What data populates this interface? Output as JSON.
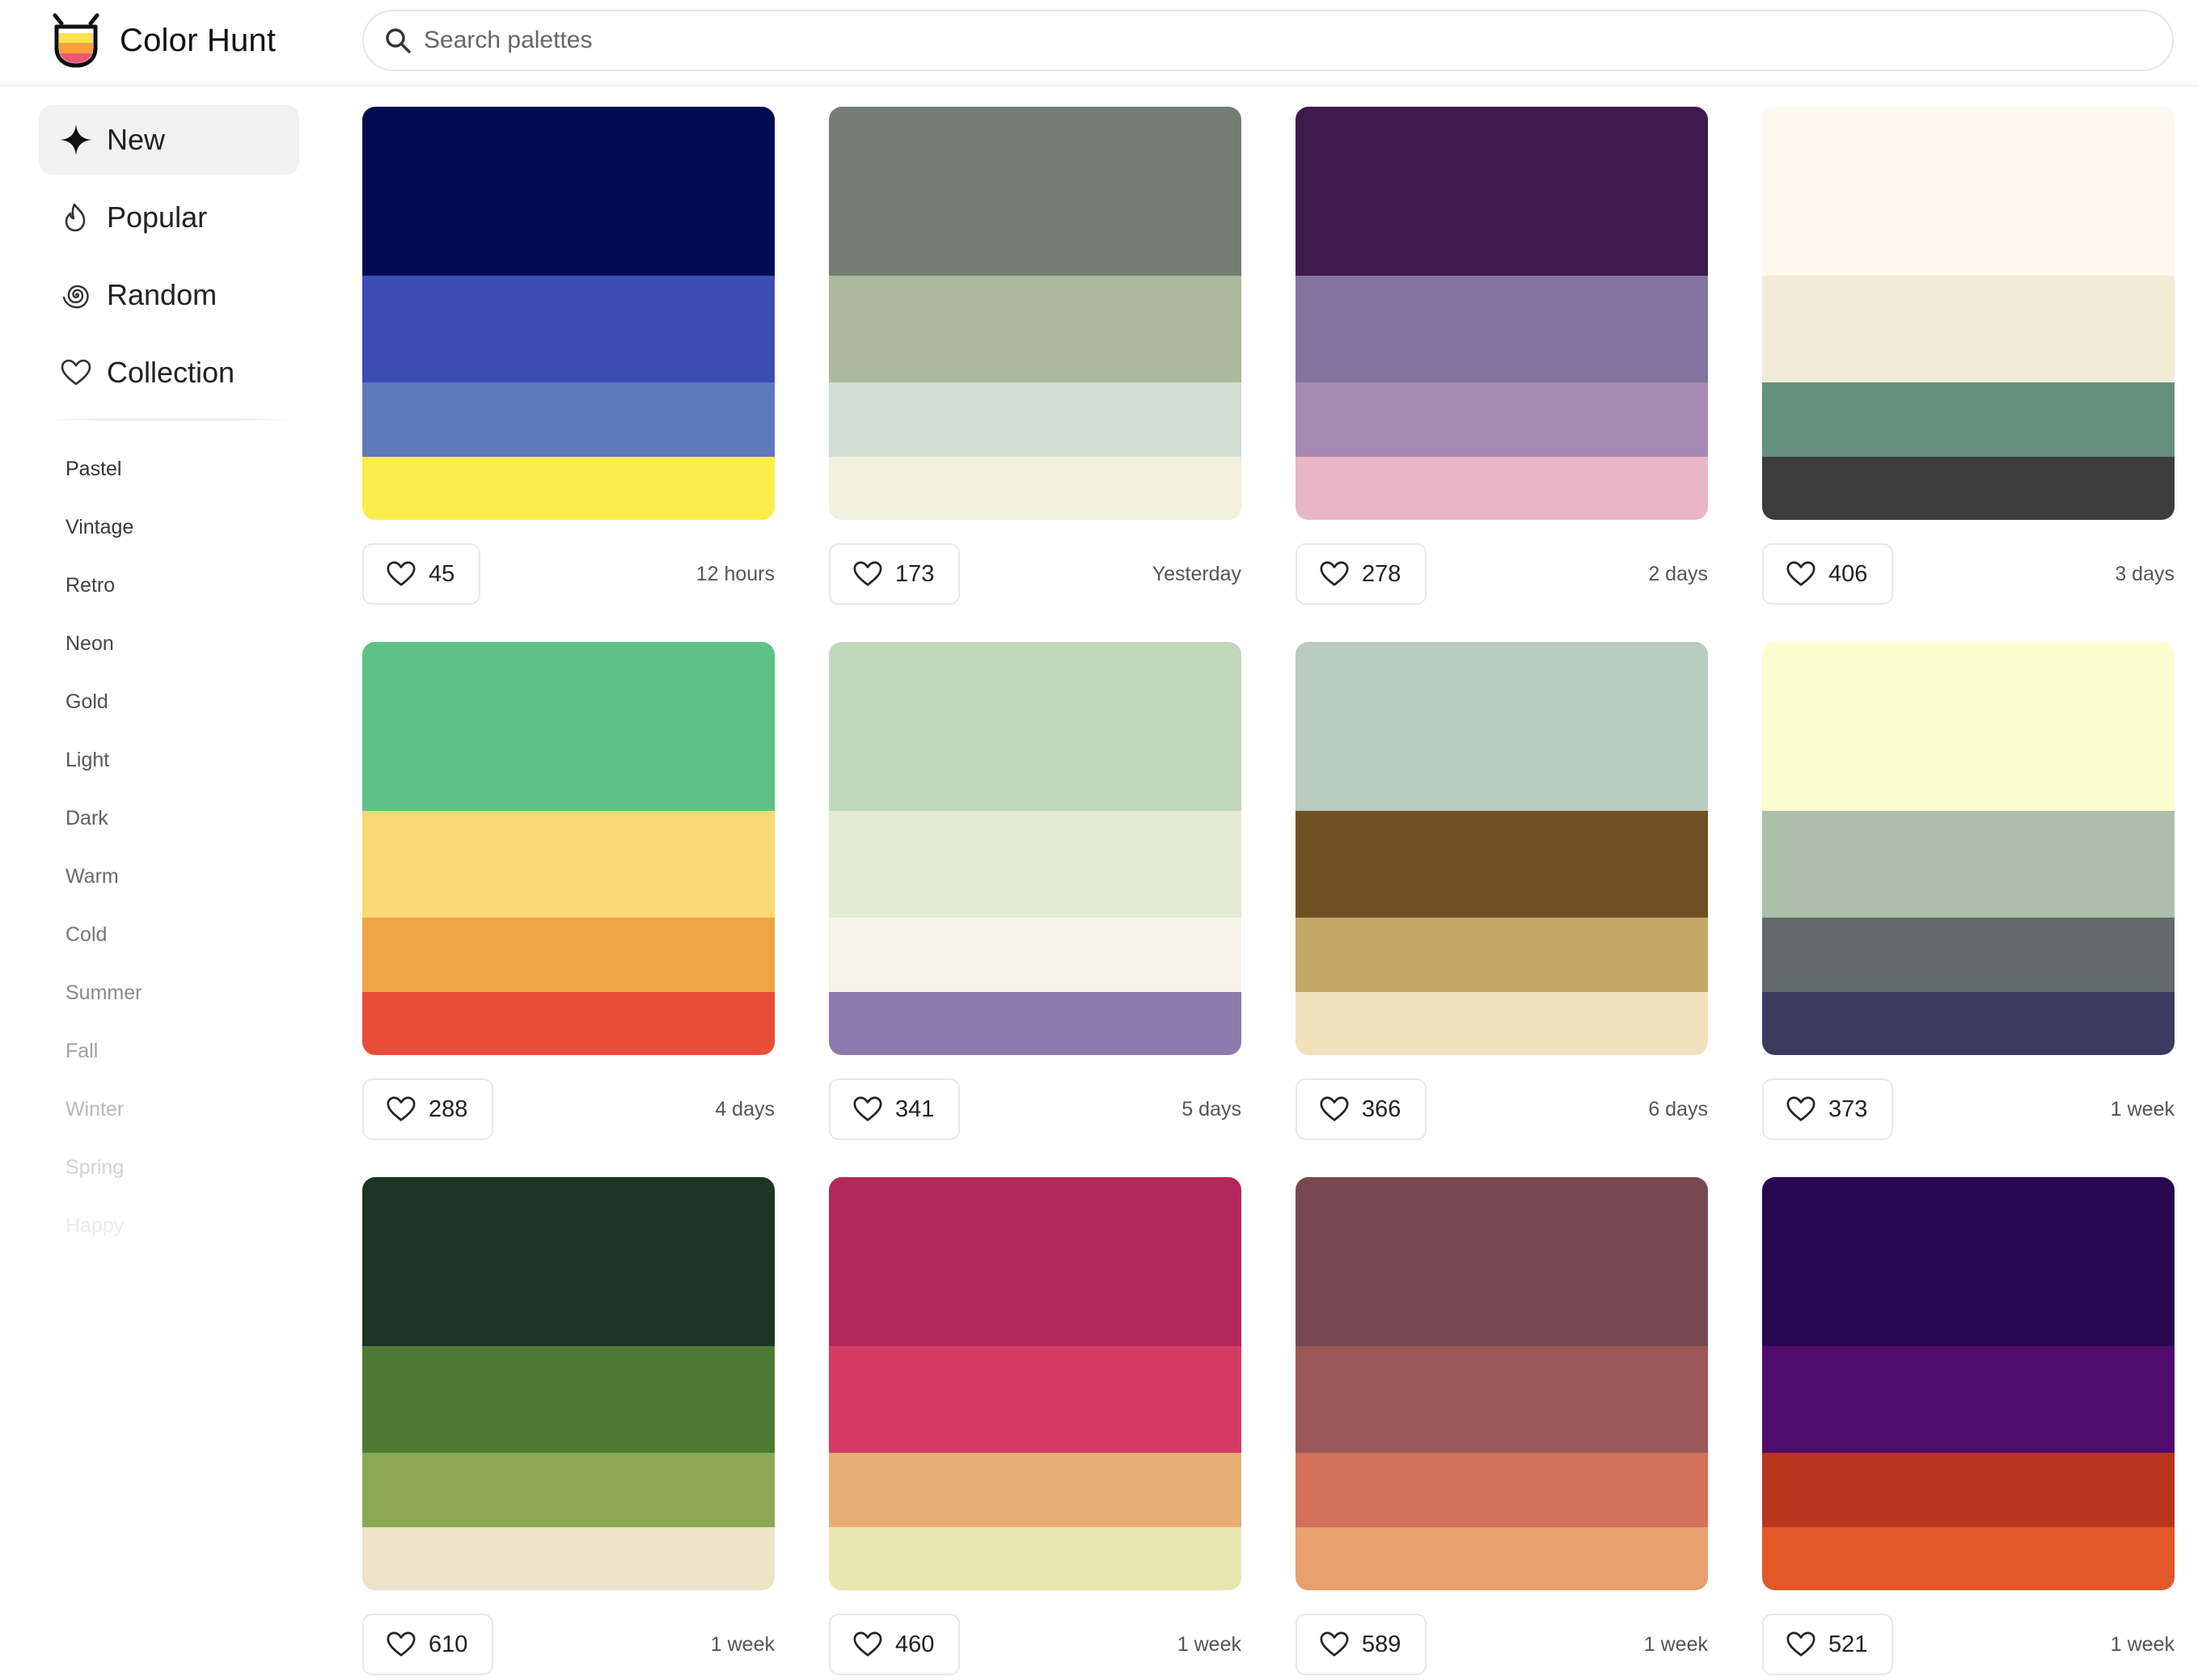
{
  "app": {
    "name": "Color Hunt"
  },
  "search": {
    "placeholder": "Search palettes",
    "value": ""
  },
  "nav": [
    {
      "label": "New",
      "icon": "sparkle-icon",
      "active": true
    },
    {
      "label": "Popular",
      "icon": "flame-icon",
      "active": false
    },
    {
      "label": "Random",
      "icon": "spiral-icon",
      "active": false
    },
    {
      "label": "Collection",
      "icon": "heart-icon",
      "active": false
    }
  ],
  "tags": [
    {
      "label": "Pastel",
      "color": "#333333"
    },
    {
      "label": "Vintage",
      "color": "#393939"
    },
    {
      "label": "Retro",
      "color": "#404040"
    },
    {
      "label": "Neon",
      "color": "#474747"
    },
    {
      "label": "Gold",
      "color": "#4f4f4f"
    },
    {
      "label": "Light",
      "color": "#575757"
    },
    {
      "label": "Dark",
      "color": "#5f5f5f"
    },
    {
      "label": "Warm",
      "color": "#6a6a6a"
    },
    {
      "label": "Cold",
      "color": "#777777"
    },
    {
      "label": "Summer",
      "color": "#8a8a8a"
    },
    {
      "label": "Fall",
      "color": "#a0a0a0"
    },
    {
      "label": "Winter",
      "color": "#b8b8b8"
    },
    {
      "label": "Spring",
      "color": "#d2d2d2"
    },
    {
      "label": "Happy",
      "color": "#ececec"
    }
  ],
  "palettes": [
    {
      "colors": [
        "#000b54",
        "#3b4cb3",
        "#5f79bd",
        "#fcec4b"
      ],
      "likes": "45",
      "date": "12 hours"
    },
    {
      "colors": [
        "#747e74",
        "#acb99d",
        "#d2ddd3",
        "#f0f0dc"
      ],
      "likes": "173",
      "date": "Yesterday"
    },
    {
      "colors": [
        "#3f1a4f",
        "#82749e",
        "#a589b2",
        "#e9b6c8"
      ],
      "likes": "278",
      "date": "2 days"
    },
    {
      "colors": [
        "#fdf9ee",
        "#f2ecd7",
        "#658f7e",
        "#3c3c3c"
      ],
      "likes": "406",
      "date": "3 days"
    },
    {
      "colors": [
        "#5cc285",
        "#f8d973",
        "#f0a445",
        "#e84d39"
      ],
      "likes": "288",
      "date": "4 days"
    },
    {
      "colors": [
        "#c1d8bc",
        "#e4ead3",
        "#f6f4e7",
        "#8b7aab"
      ],
      "likes": "341",
      "date": "5 days"
    },
    {
      "colors": [
        "#bacbbf",
        "#6f5025",
        "#c5a768",
        "#f2e1bc"
      ],
      "likes": "366",
      "date": "6 days"
    },
    {
      "colors": [
        "#fafdcd",
        "#adbfaa",
        "#626a6b",
        "#3b3b5f"
      ],
      "likes": "373",
      "date": "1 week"
    },
    {
      "colors": [
        "#1d3526",
        "#4d7b33",
        "#8ca854",
        "#ece3c8"
      ],
      "likes": "610",
      "date": "1 week"
    },
    {
      "colors": [
        "#b3285b",
        "#d53c65",
        "#e8ae75",
        "#e8e7b0"
      ],
      "likes": "460",
      "date": "1 week"
    },
    {
      "colors": [
        "#784850",
        "#9b5857",
        "#d2705b",
        "#e8a06f"
      ],
      "likes": "589",
      "date": "1 week"
    },
    {
      "colors": [
        "#290650",
        "#4f0b6d",
        "#b8351e",
        "#e05728"
      ],
      "likes": "521",
      "date": "1 week"
    }
  ]
}
